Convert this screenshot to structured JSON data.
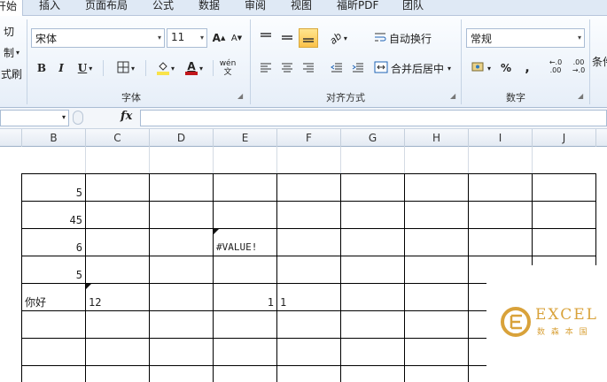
{
  "ribbon_tabs": {
    "start_partial": "开始",
    "insert": "插入",
    "page_layout": "页面布局",
    "formulas": "公式",
    "data": "数据",
    "review": "审阅",
    "view": "视图",
    "foxit_pdf": "福昕PDF",
    "team": "团队"
  },
  "clipboard": {
    "cut_partial": "切",
    "copy_partial": "制",
    "format_painter_partial": "式刷"
  },
  "font": {
    "name": "宋体",
    "size": "11",
    "bold": "B",
    "italic": "I",
    "underline": "U",
    "fill_letter": "A",
    "font_color_letter": "A",
    "phonetic": "wén",
    "group_label": "字体",
    "grow": "A",
    "shrink": "A"
  },
  "alignment": {
    "wrap_text": "自动换行",
    "merge_center": "合并后居中",
    "group_label": "对齐方式"
  },
  "number": {
    "format": "常规",
    "percent": "%",
    "comma": ",",
    "increase_decimal": "←.0\n.00",
    "decrease_decimal": ".00\n→.0",
    "group_label": "数字"
  },
  "styles_partial": "条件",
  "formula_bar": {
    "name_box": "",
    "fx": "fx",
    "content": ""
  },
  "columns": [
    "B",
    "C",
    "D",
    "E",
    "F",
    "G",
    "H",
    "I",
    "J"
  ],
  "cells": {
    "b2": "5",
    "b3": "45",
    "b4": "6",
    "b5": "5",
    "b6": "你好",
    "c6": "12",
    "e4": "#VALUE!",
    "e6": "1",
    "f6": "1"
  },
  "logo": {
    "brand": "EXCEL",
    "tagline": "数 森 本 国"
  },
  "colors": {
    "accent": "#f9c642",
    "logo_gold": "#d9a23a",
    "ribbon_bg": "#e6eef8"
  }
}
